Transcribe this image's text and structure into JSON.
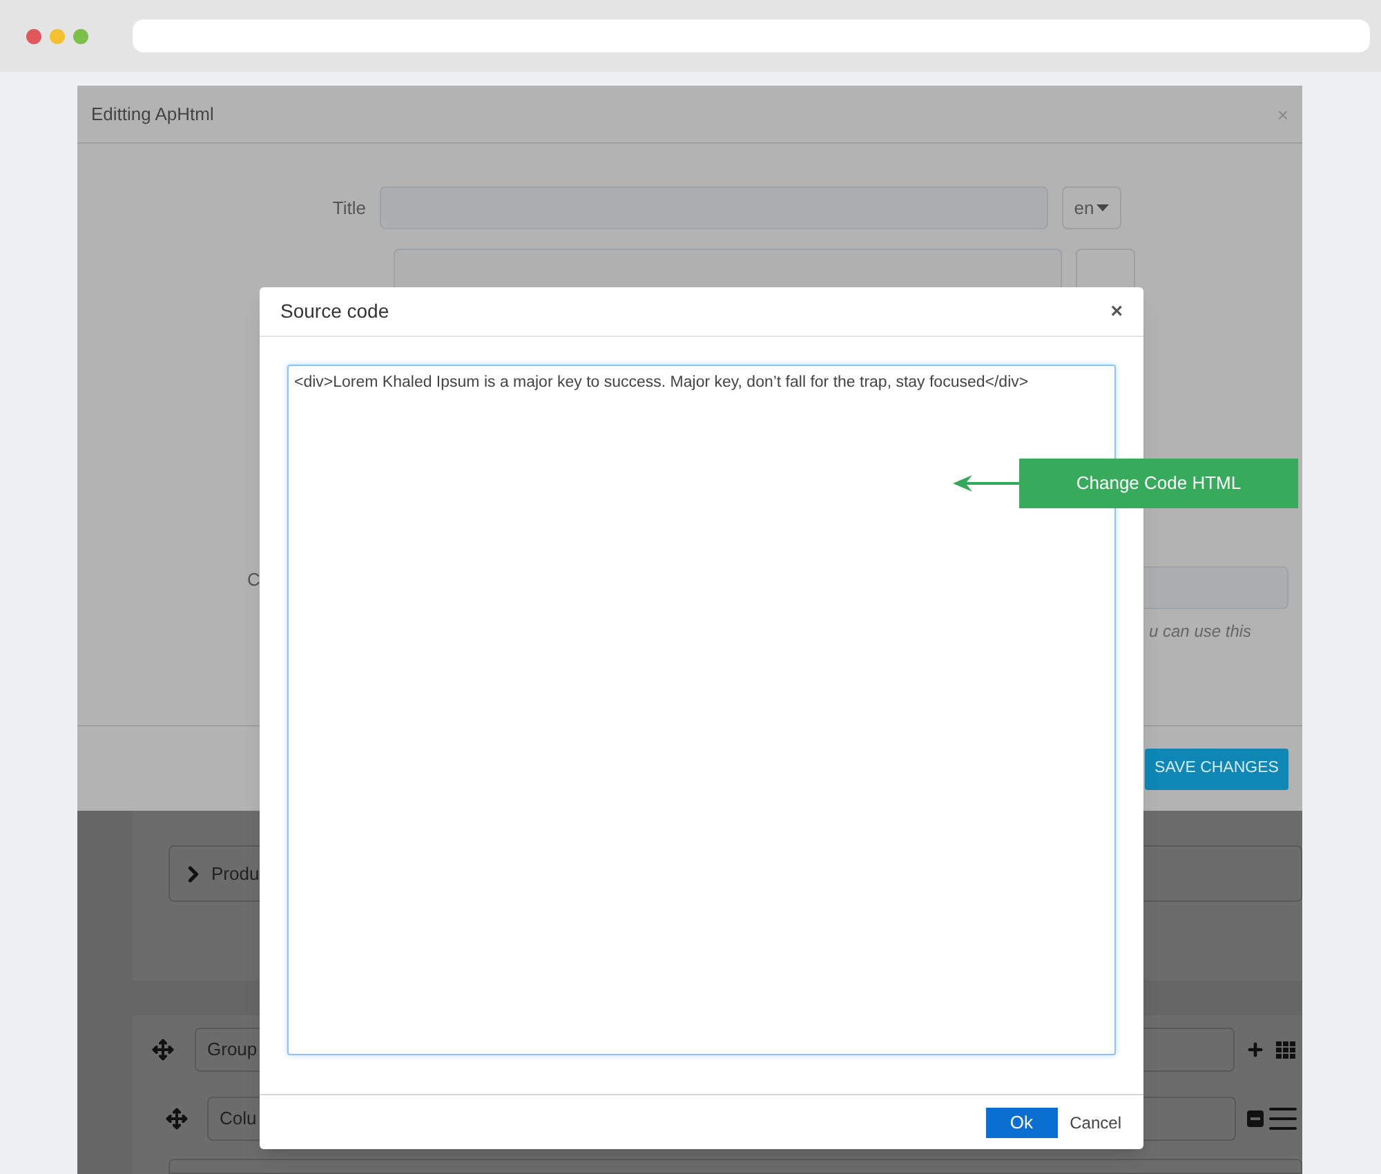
{
  "editor_modal": {
    "title": "Editting ApHtml",
    "close": "×",
    "title_field": {
      "label": "Title",
      "language": "en"
    },
    "partial_label": "C",
    "hint": "u can use this",
    "save_button": "SAVE CHANGES"
  },
  "builder": {
    "product_row": "Produ",
    "group_row": {
      "label": "Group"
    },
    "column_row": {
      "label": "Colu"
    }
  },
  "source_dialog": {
    "title": "Source code",
    "close": "×",
    "code": "<div>Lorem Khaled Ipsum is a major key to success. Major key, don’t fall for the trap, stay focused</div>",
    "ok": "Ok",
    "cancel": "Cancel"
  },
  "callout": {
    "text": "Change Code HTML"
  }
}
